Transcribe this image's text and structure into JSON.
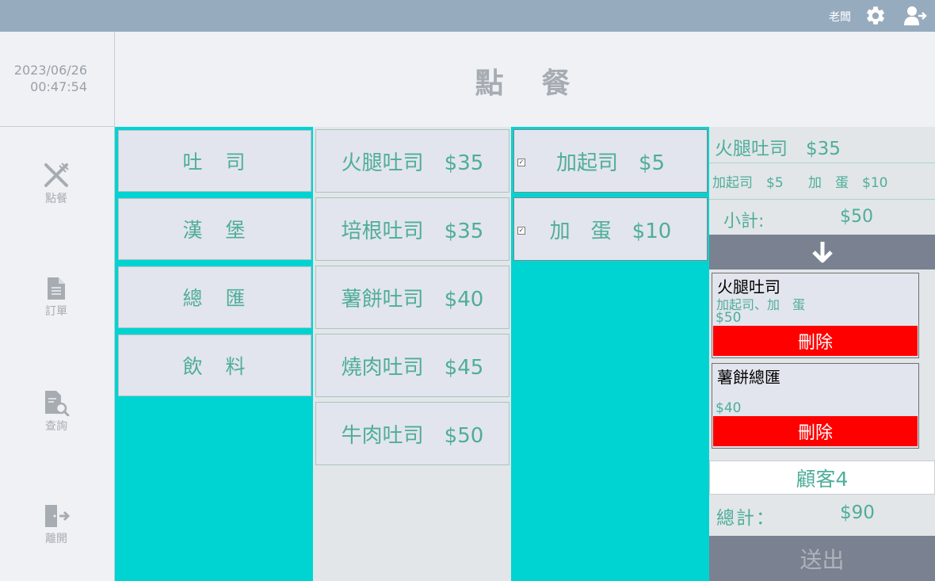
{
  "header": {
    "user": "老闆",
    "settings_icon": "gear-icon",
    "switch_user_icon": "switch-user-icon",
    "bg_color": "#97abbf"
  },
  "clock": {
    "date": "2023/06/26",
    "time": "00:47:54"
  },
  "page": {
    "title": "點　餐"
  },
  "sidebar": {
    "items": [
      {
        "label": "點餐",
        "icon": "utensils-icon"
      },
      {
        "label": "訂單",
        "icon": "document-icon"
      },
      {
        "label": "查詢",
        "icon": "search-document-icon"
      },
      {
        "label": "離開",
        "icon": "exit-icon"
      }
    ]
  },
  "categories": [
    "吐　司",
    "漢　堡",
    "總　匯",
    "飲　料"
  ],
  "items": [
    "火腿吐司　$35",
    "培根吐司　$35",
    "薯餅吐司　$40",
    "燒肉吐司　$45",
    "牛肉吐司　$50"
  ],
  "options": [
    {
      "label": "加起司　$5",
      "checked": true
    },
    {
      "label": "加　蛋　$10",
      "checked": true
    }
  ],
  "summary": {
    "current_item": "火腿吐司　$35",
    "current_options": [
      "加起司　$5",
      "加　蛋　$10"
    ],
    "subtotal_label": "小計:",
    "subtotal_value": "$50",
    "add_icon": "arrow-down-icon"
  },
  "orders": [
    {
      "name": "火腿吐司",
      "options": "加起司、加　蛋",
      "price": "$50",
      "delete_label": "刪除"
    },
    {
      "name": "薯餅總匯",
      "options": "",
      "price": "$40",
      "delete_label": "刪除"
    }
  ],
  "customer": "顧客4",
  "total": {
    "label": "總計：",
    "value": "$90"
  },
  "submit_label": "送出",
  "colors": {
    "accent": "#00d4d2",
    "text": "#4fad9a",
    "delete": "#ff0000",
    "button_dark": "#7a8291"
  }
}
